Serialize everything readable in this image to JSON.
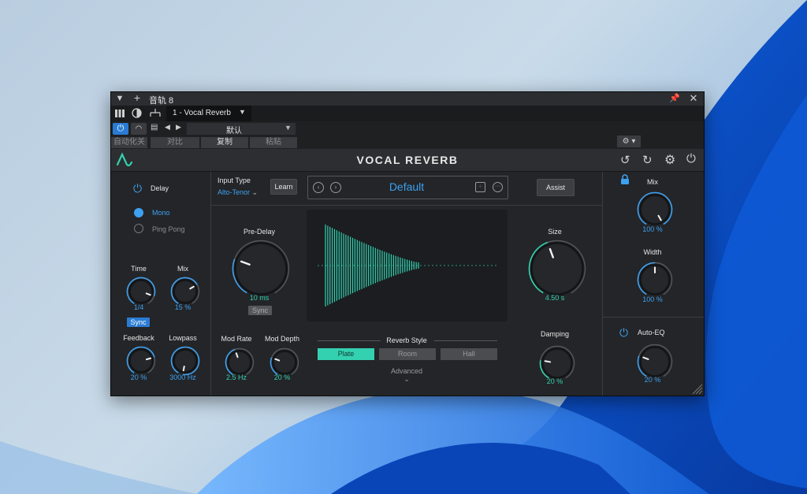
{
  "host": {
    "track_name": "音轨 8",
    "plugin_slot": "1 - Vocal Reverb",
    "preset": "默认",
    "auto_label": "自动化关",
    "compare_label": "对比",
    "copy_label": "复制",
    "paste_label": "粘贴"
  },
  "plugin": {
    "title": "VOCAL REVERB",
    "accent_blue": "#3ea0f0",
    "accent_green": "#33d1b0",
    "delay": {
      "label": "Delay",
      "mono_label": "Mono",
      "pingpong_label": "Ping Pong",
      "mode_selected": "Mono",
      "time_label": "Time",
      "time_value": "1/4",
      "mix_label": "Mix",
      "mix_value": "15 %",
      "sync_label": "Sync",
      "feedback_label": "Feedback",
      "feedback_value": "20 %",
      "lowpass_label": "Lowpass",
      "lowpass_value": "3000 Hz"
    },
    "input": {
      "type_label": "Input Type",
      "type_value": "Alto-Tenor",
      "learn_label": "Learn",
      "preset_name": "Default",
      "assist_label": "Assist"
    },
    "reverb": {
      "predelay_label": "Pre-Delay",
      "predelay_value": "10 ms",
      "predelay_sync": "Sync",
      "size_label": "Size",
      "size_value": "4.50 s",
      "damping_label": "Damping",
      "damping_value": "20 %",
      "modrate_label": "Mod Rate",
      "modrate_value": "2.5 Hz",
      "moddepth_label": "Mod Depth",
      "moddepth_value": "20 %",
      "style_label": "Reverb Style",
      "styles": [
        "Plate",
        "Room",
        "Hall"
      ],
      "style_selected": "Plate",
      "advanced_label": "Advanced"
    },
    "output": {
      "mix_label": "Mix",
      "mix_value": "100 %",
      "width_label": "Width",
      "width_value": "100 %",
      "autoeq_label": "Auto-EQ",
      "autoeq_value": "20 %"
    }
  }
}
